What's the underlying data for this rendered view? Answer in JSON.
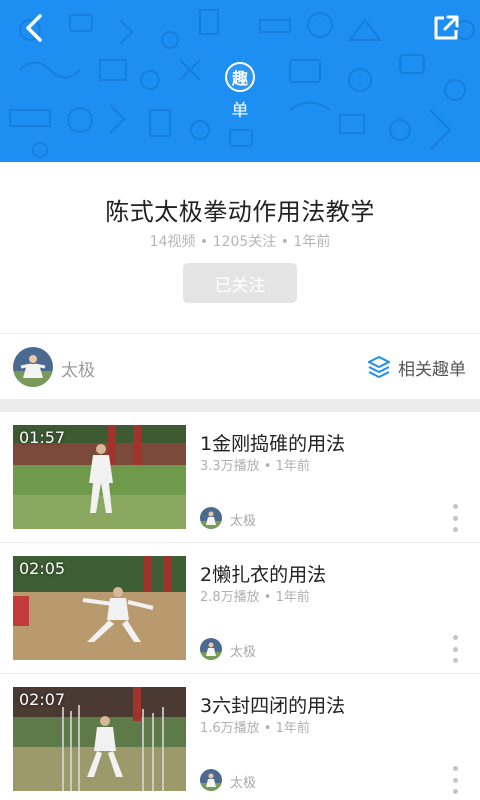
{
  "colors": {
    "banner": "#1d8ff2",
    "accent": "#1d8ff2"
  },
  "header": {
    "back_icon": "chevron-left-icon",
    "share_icon": "share-external-icon",
    "badge_char": "趣",
    "badge_sub": "单"
  },
  "playlist": {
    "title": "陈式太极拳动作用法教学",
    "meta": "14视频 • 1205关注 • 1年前",
    "follow_label": "已关注"
  },
  "author": {
    "name": "太极",
    "related_icon": "layers-icon",
    "related_label": "相关趣单"
  },
  "videos": [
    {
      "duration": "01:57",
      "title": "1金刚捣碓的用法",
      "meta": "3.3万播放 • 1年前",
      "author": "太极"
    },
    {
      "duration": "02:05",
      "title": "2懒扎衣的用法",
      "meta": "2.8万播放 • 1年前",
      "author": "太极"
    },
    {
      "duration": "02:07",
      "title": "3六封四闭的用法",
      "meta": "1.6万播放 • 1年前",
      "author": "太极"
    }
  ]
}
